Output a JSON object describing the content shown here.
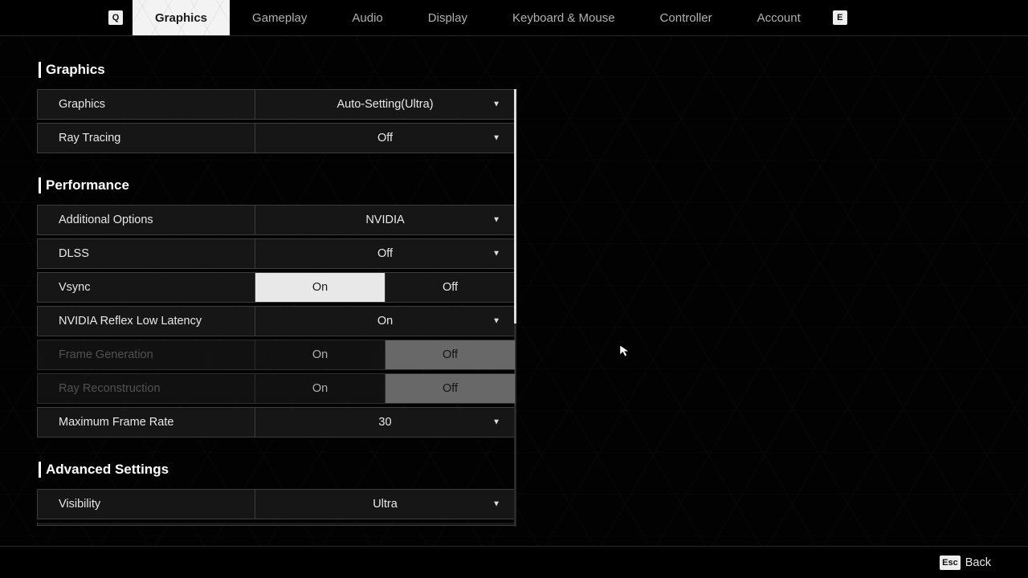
{
  "nav": {
    "prev_key": "Q",
    "next_key": "E",
    "tabs": [
      "Graphics",
      "Gameplay",
      "Audio",
      "Display",
      "Keyboard & Mouse",
      "Controller",
      "Account"
    ],
    "active": 0
  },
  "footer": {
    "key": "Esc",
    "label": "Back"
  },
  "toggle_labels": {
    "on": "On",
    "off": "Off"
  },
  "sections": {
    "graphics": {
      "title": "Graphics",
      "rows": {
        "graphics": {
          "label": "Graphics",
          "value": "Auto-Setting(Ultra)"
        },
        "raytracing": {
          "label": "Ray Tracing",
          "value": "Off"
        }
      }
    },
    "performance": {
      "title": "Performance",
      "rows": {
        "addopts": {
          "label": "Additional Options",
          "value": "NVIDIA"
        },
        "dlss": {
          "label": "DLSS",
          "value": "Off"
        },
        "vsync": {
          "label": "Vsync"
        },
        "reflex": {
          "label": "NVIDIA Reflex Low Latency",
          "value": "On"
        },
        "framegen": {
          "label": "Frame Generation"
        },
        "rayrecon": {
          "label": "Ray Reconstruction"
        },
        "maxfps": {
          "label": "Maximum Frame Rate",
          "value": "30"
        }
      }
    },
    "advanced": {
      "title": "Advanced Settings",
      "rows": {
        "visibility": {
          "label": "Visibility",
          "value": "Ultra"
        }
      }
    }
  }
}
